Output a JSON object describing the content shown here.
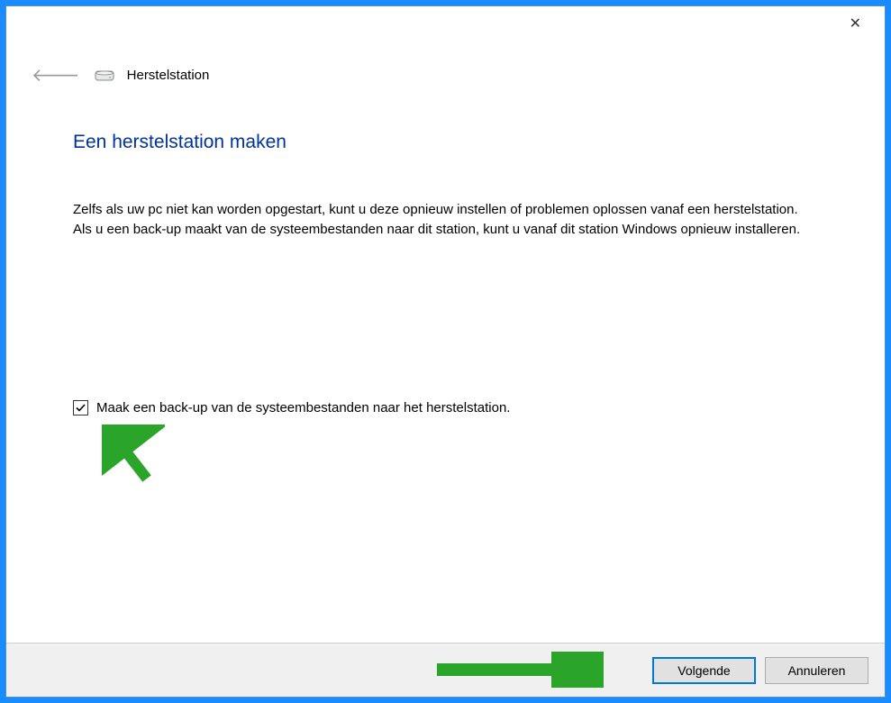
{
  "window": {
    "title": "Herstelstation"
  },
  "page": {
    "heading": "Een herstelstation maken",
    "description": "Zelfs als uw pc niet kan worden opgestart, kunt u deze opnieuw instellen of problemen oplossen vanaf een herstelstation. Als u een back-up maakt van de systeembestanden naar dit station, kunt u vanaf dit station Windows opnieuw installeren."
  },
  "checkbox": {
    "label": "Maak een back-up van de systeembestanden naar het herstelstation.",
    "checked": true
  },
  "buttons": {
    "next": "Volgende",
    "cancel": "Annuleren"
  }
}
